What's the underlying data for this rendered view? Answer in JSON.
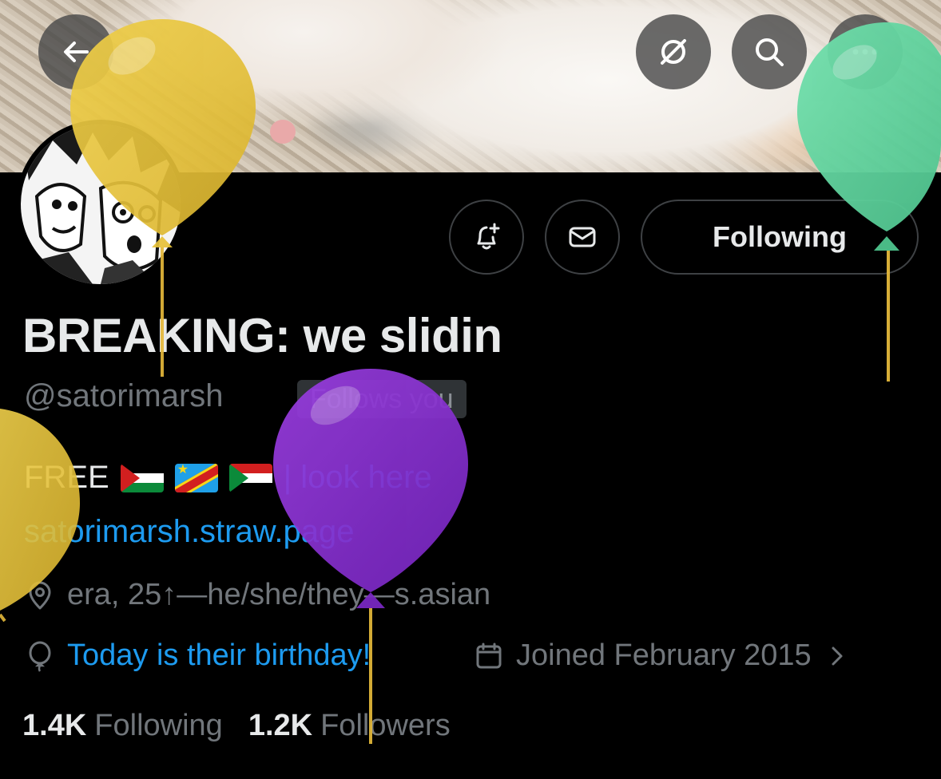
{
  "header": {
    "back_icon": "arrow-left-icon",
    "grok_icon": "grok-icon",
    "search_icon": "search-icon",
    "more_icon": "more-icon"
  },
  "actions": {
    "notify_icon": "bell-plus-icon",
    "message_icon": "envelope-icon",
    "following_label": "Following"
  },
  "profile": {
    "display_name": "BREAKING: we slidin",
    "handle": "@satorimarsh",
    "follows_you": "Follows you",
    "bio_prefix": "FREE",
    "bio_flags": [
      "flag-palestine",
      "flag-congo",
      "flag-sudan"
    ],
    "bio_suffix": "| look here",
    "website": "satorimarsh.straw.page",
    "location": "era, 25↑—he/she/they—s.asian",
    "birthday": "Today is their birthday!",
    "joined": "Joined February 2015"
  },
  "stats": {
    "following_count": "1.4K",
    "following_label": "Following",
    "followers_count": "1.2K",
    "followers_label": "Followers"
  },
  "colors": {
    "background": "#000000",
    "text_primary": "#e7e9ea",
    "text_secondary": "#71767b",
    "link": "#1d9bf0",
    "border": "#3e4144",
    "balloon_yellow": "#e5c23a",
    "balloon_green": "#5fd6a0",
    "balloon_purple": "#8a2ed0"
  }
}
